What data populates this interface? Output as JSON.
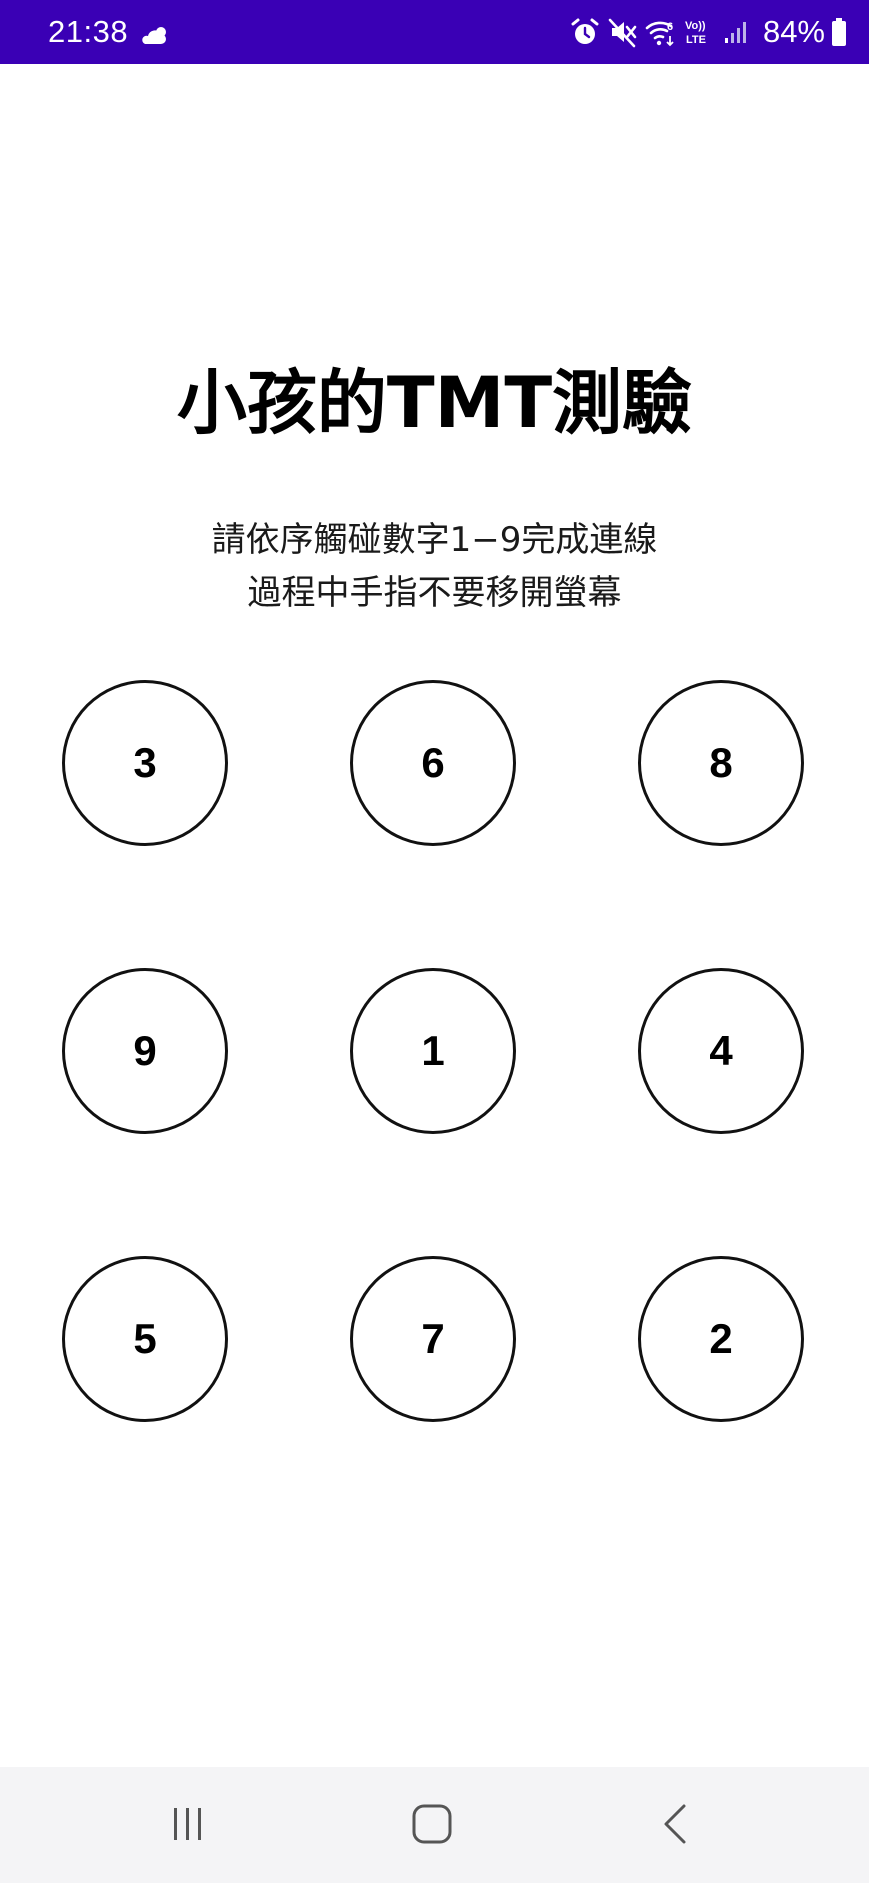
{
  "status_bar": {
    "time": "21:38",
    "battery": "84%",
    "background_color": "#3a00b5",
    "icons": [
      "weather-cloud-sun-icon",
      "alarm-icon",
      "mute-icon",
      "wifi-6-icon",
      "volte-icon",
      "signal-icon",
      "battery-icon"
    ],
    "volte_line1": "Vo))",
    "volte_line2": "LTE"
  },
  "title": "小孩的TMT測驗",
  "instructions": {
    "line1": "請依序觸碰數字1−9完成連線",
    "line2": "過程中手指不要移開螢幕"
  },
  "grid": {
    "rows": [
      [
        "3",
        "6",
        "8"
      ],
      [
        "9",
        "1",
        "4"
      ],
      [
        "5",
        "7",
        "2"
      ]
    ]
  },
  "nav_bar": {
    "buttons": [
      "recent-apps",
      "home",
      "back"
    ]
  }
}
